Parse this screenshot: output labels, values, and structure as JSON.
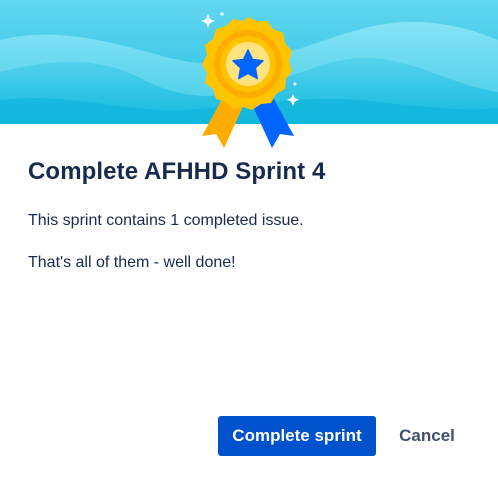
{
  "dialog": {
    "title": "Complete AFHHD Sprint 4",
    "body_line_1": "This sprint contains 1 completed issue.",
    "body_line_2": "That's all of them - well done!",
    "primary_button": "Complete sprint",
    "cancel_button": "Cancel"
  },
  "illustration": {
    "icon": "award-badge-icon",
    "star_icon": "star-icon"
  },
  "colors": {
    "title_text": "#172b4d",
    "primary_button_bg": "#0052cc",
    "primary_button_text": "#ffffff",
    "cancel_text": "#42526e",
    "header_sky": "#2ec5e3",
    "badge_gold": "#ffc400",
    "ribbon_blue": "#0065ff"
  }
}
